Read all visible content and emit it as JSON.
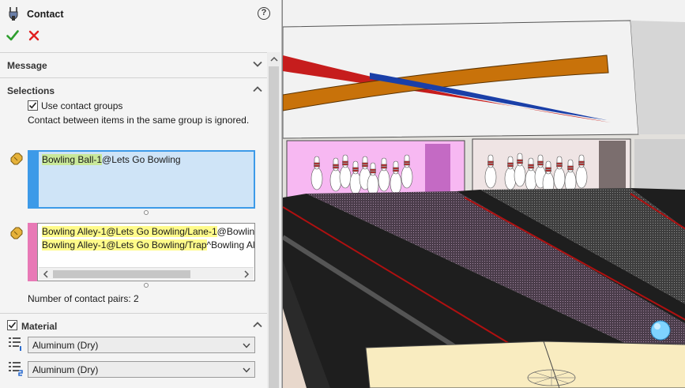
{
  "panel": {
    "title": "Contact",
    "help_symbol": "?",
    "ok_icon": "checkmark-icon",
    "cancel_icon": "x-icon",
    "accent": "#3d9ae8"
  },
  "groups": {
    "message": {
      "title": "Message",
      "expanded": false
    },
    "selections": {
      "title": "Selections",
      "expanded": true,
      "use_groups_label": "Use contact groups",
      "use_groups_checked": true,
      "note": "Contact between items in the same group is ignored.",
      "group1": {
        "color": "#3d9ae8",
        "items": [
          {
            "highlight": "Bowling Ball-1",
            "rest": "@Lets Go Bowling"
          }
        ]
      },
      "group2": {
        "color": "#e879b6",
        "items": [
          {
            "highlight": "Bowling Alley-1@Lets Go Bowling/Lane-1",
            "rest": "@Bowling"
          },
          {
            "highlight": "Bowling Alley-1@Lets Go Bowling/Trap",
            "rest": "^Bowling All"
          }
        ]
      },
      "pairs_label": "Number of contact pairs: 2"
    },
    "material": {
      "title": "Material",
      "checked": true,
      "material1": "Aluminum (Dry)",
      "material2": "Aluminum (Dry)"
    }
  }
}
